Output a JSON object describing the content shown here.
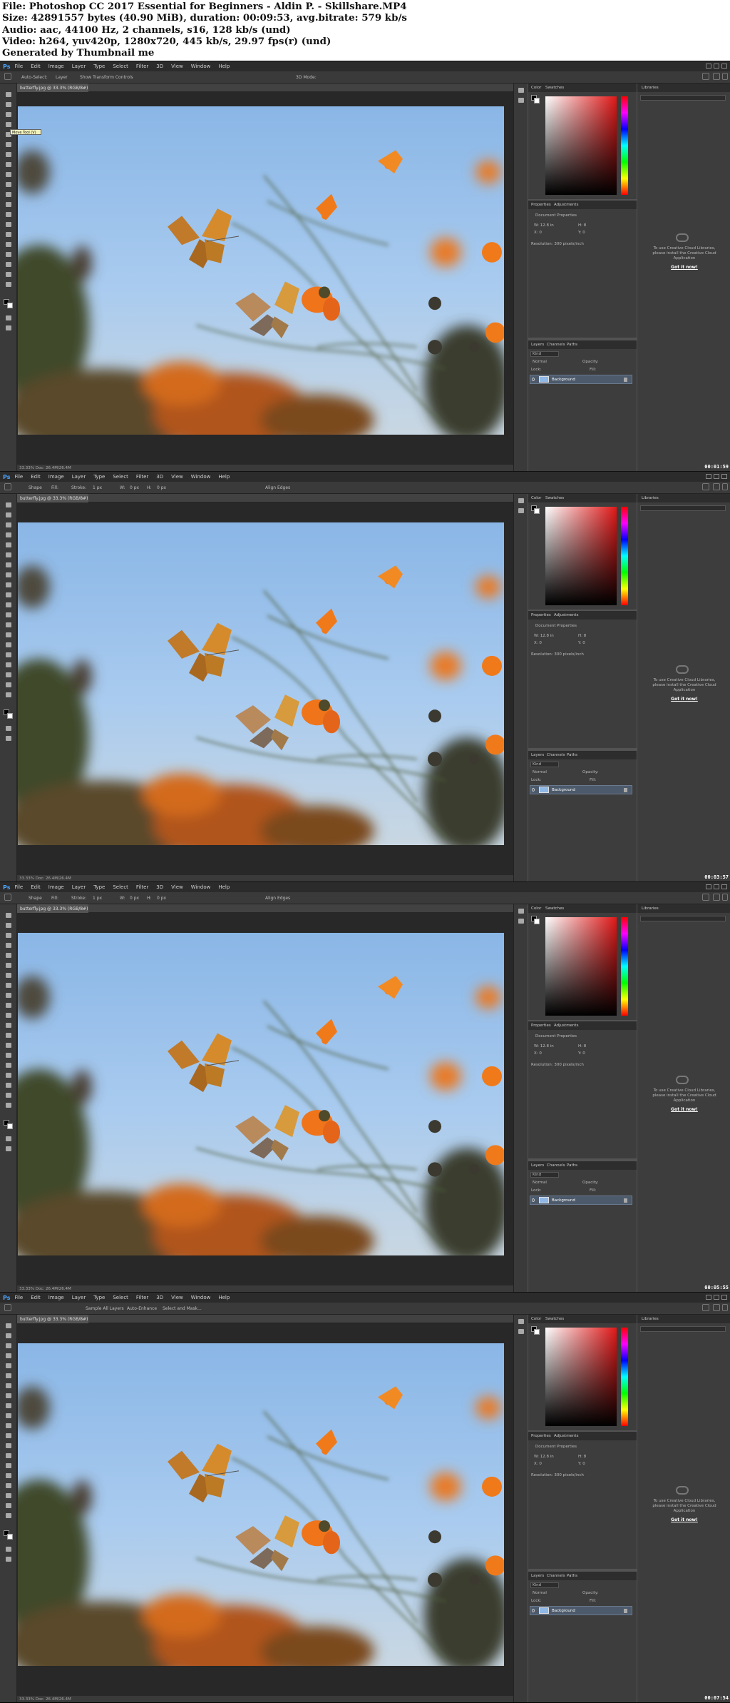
{
  "info": {
    "line1": "File: Photoshop CC 2017 Essential for Beginners - Aldin P. - Skillshare.MP4",
    "line2": "Size: 42891557 bytes (40.90 MiB), duration: 00:09:53, avg.bitrate: 579 kb/s",
    "line3": "Audio: aac, 44100 Hz, 2 channels, s16, 128 kb/s (und)",
    "line4": "Video: h264, yuv420p, 1280x720, 445 kb/s, 29.97 fps(r) (und)",
    "line5": "Generated by Thumbnail me"
  },
  "app": {
    "logo": "Ps",
    "menu": [
      "File",
      "Edit",
      "Image",
      "Layer",
      "Type",
      "Select",
      "Filter",
      "3D",
      "View",
      "Window",
      "Help"
    ],
    "doc_tab": "butterfly.jpg @ 33.3% (RGB/8#)",
    "status": "33.33%    Doc: 26.4M/26.4M",
    "color_tabs": [
      "Color",
      "Swatches"
    ],
    "props_tabs": [
      "Properties",
      "Adjustments"
    ],
    "props_title": "Document Properties",
    "props_w": "W:  12.8 in",
    "props_h": "H:  8",
    "props_x": "X:  0",
    "props_y": "Y:  0",
    "props_res": "Resolution: 300 pixels/inch",
    "layers_tabs": [
      "Layers",
      "Channels",
      "Paths"
    ],
    "layers_kind": "Kind",
    "layers_mode": "Normal",
    "layers_opacity": "Opacity:",
    "layers_lock": "Lock:",
    "layers_fill": "Fill:",
    "layer_name": "Background",
    "libraries_tab": "Libraries",
    "lib_message": "To use Creative Cloud Libraries, please install the Creative Cloud Application",
    "lib_link": "Got it now!"
  },
  "frames": [
    {
      "timecode": "00:01:59",
      "tooltip": "Move Tool (V)",
      "options": [
        "Auto-Select:",
        "Layer",
        "Show Transform Controls",
        "3D Mode:"
      ]
    },
    {
      "timecode": "00:03:57",
      "options": [
        "Shape",
        "Fill:",
        "Stroke:",
        "1 px",
        "W:",
        "0 px",
        "H:",
        "0 px",
        "Align Edges"
      ]
    },
    {
      "timecode": "00:05:55",
      "options": [
        "Shape",
        "Fill:",
        "Stroke:",
        "1 px",
        "W:",
        "0 px",
        "H:",
        "0 px",
        "Align Edges"
      ]
    },
    {
      "timecode": "00:07:54",
      "options": [
        "Sample All Layers",
        "Auto-Enhance",
        "Select and Mask..."
      ]
    }
  ],
  "colors": {
    "ui_dark": "#2b2b2b",
    "ui_mid": "#3a3a3a",
    "panel": "#535353",
    "sky": "#8fb8e6",
    "flower": "#f07a1a"
  },
  "icons": [
    "ps-logo",
    "move-tool-icon",
    "marquee-icon",
    "lasso-icon",
    "crop-icon",
    "eyedropper-icon",
    "brush-icon",
    "eraser-icon",
    "pen-icon",
    "type-icon",
    "hand-icon",
    "zoom-icon",
    "search-icon"
  ]
}
